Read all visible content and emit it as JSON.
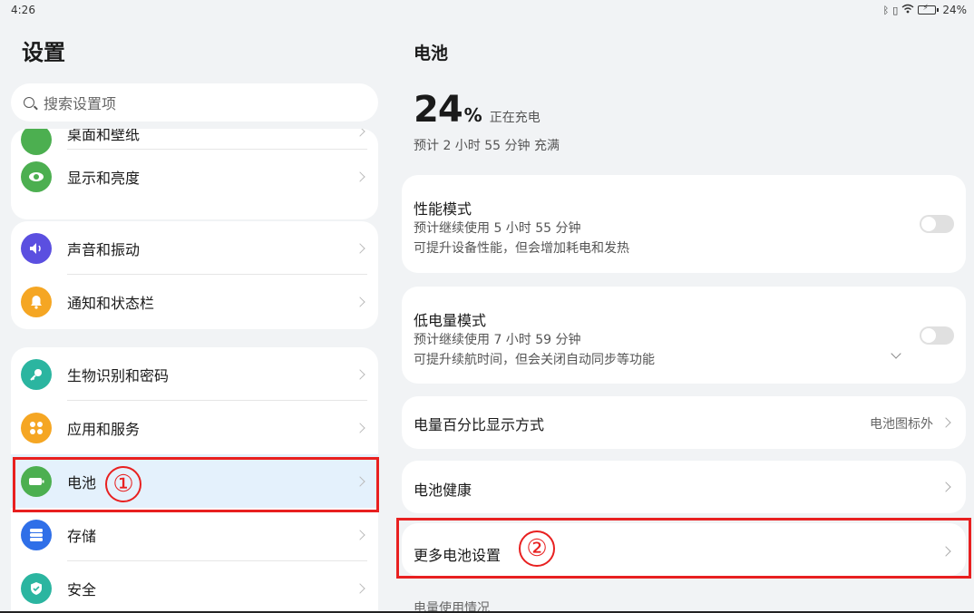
{
  "status_bar": {
    "time": "4:26",
    "battery": "24%"
  },
  "left": {
    "title": "设置",
    "search_placeholder": "搜索设置项",
    "partial_item": "桌面和壁纸",
    "items": [
      {
        "label": "显示和亮度",
        "icon": "eye-icon",
        "color": "#4caf50"
      },
      {
        "label": "声音和振动",
        "icon": "speaker-icon",
        "color": "#5b4fe0"
      },
      {
        "label": "通知和状态栏",
        "icon": "bell-icon",
        "color": "#f5a623"
      },
      {
        "label": "生物识别和密码",
        "icon": "key-icon",
        "color": "#2bb5a0"
      },
      {
        "label": "应用和服务",
        "icon": "apps-icon",
        "color": "#f5a623"
      },
      {
        "label": "电池",
        "icon": "battery-icon",
        "color": "#4caf50"
      },
      {
        "label": "存储",
        "icon": "storage-icon",
        "color": "#2f6fe8"
      },
      {
        "label": "安全",
        "icon": "shield-icon",
        "color": "#2bb5a0"
      }
    ]
  },
  "annotations": {
    "one": "①",
    "two": "②"
  },
  "right": {
    "title": "电池",
    "percent": "24",
    "percent_symbol": "%",
    "charging": "正在充电",
    "estimate": "预计 2 小时 55 分钟 充满",
    "performance": {
      "title": "性能模式",
      "sub1": "预计继续使用 5 小时 55 分钟",
      "sub2": "可提升设备性能，但会增加耗电和发热"
    },
    "low_power": {
      "title": "低电量模式",
      "sub1": "预计继续使用 7 小时 59 分钟",
      "sub2": "可提升续航时间，但会关闭自动同步等功能"
    },
    "display_mode": {
      "title": "电量百分比显示方式",
      "value": "电池图标外"
    },
    "health": "电池健康",
    "more": "更多电池设置",
    "usage": "电量使用情况"
  }
}
